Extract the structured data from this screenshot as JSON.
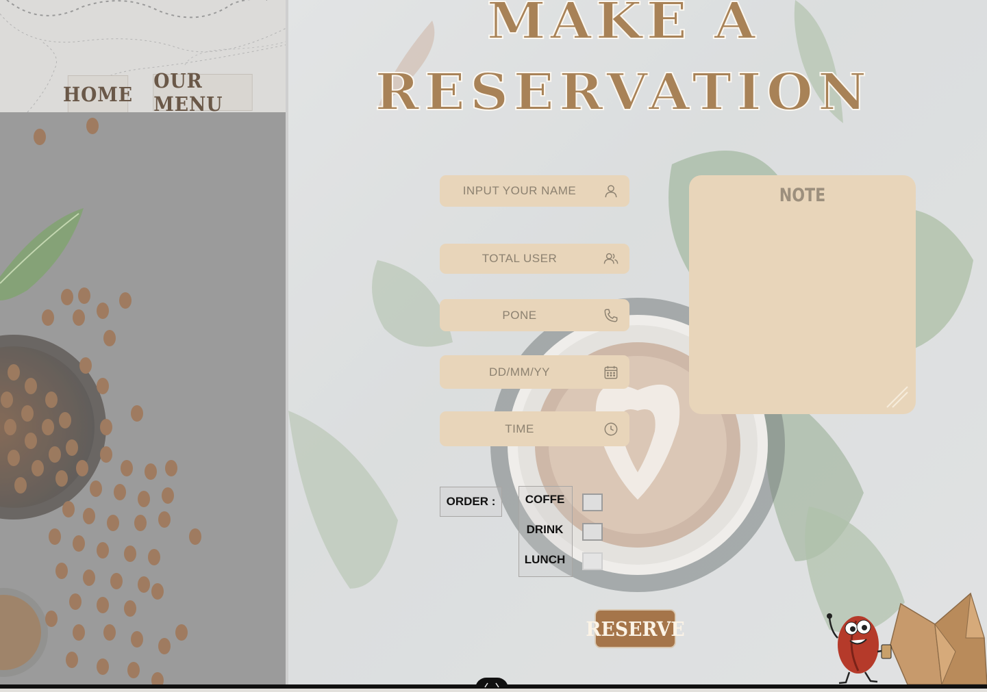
{
  "nav": {
    "home": "HOME",
    "menu": "OUR MENU"
  },
  "title": {
    "line1": "MAKE A",
    "line2": "RESERVATION"
  },
  "form": {
    "name_placeholder": "INPUT YOUR NAME",
    "users_placeholder": "TOTAL USER",
    "phone_placeholder": "PONE",
    "date_placeholder": "DD/MM/YY",
    "time_placeholder": "TIME",
    "note_placeholder": "NOTE"
  },
  "order": {
    "label": "ORDER :",
    "options": [
      "COFFE",
      "DRINK",
      "LUNCH"
    ]
  },
  "reserve_label": "RESERVE",
  "icons": [
    "user-icon",
    "users-icon",
    "phone-icon",
    "calendar-icon",
    "clock-icon",
    "coffee-bean-mascot-icon"
  ],
  "colors": {
    "accent": "#a88257",
    "field": "#e8d5ba",
    "button": "#a5754a"
  }
}
